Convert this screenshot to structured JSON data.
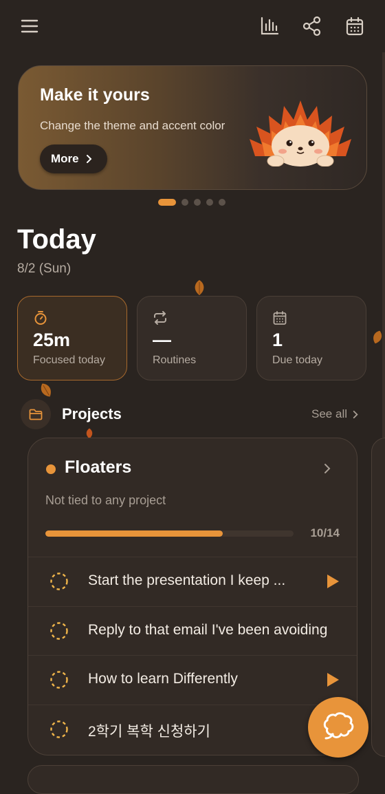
{
  "banner": {
    "title": "Make it yours",
    "subtitle": "Change the theme and accent color",
    "more_label": "More",
    "page_count": 5,
    "active_page": 1
  },
  "today": {
    "title": "Today",
    "date": "8/2 (Sun)"
  },
  "stats": [
    {
      "value": "25m",
      "label": "Focused today",
      "icon": "timer-icon"
    },
    {
      "value": "—",
      "label": "Routines",
      "icon": "repeat-icon"
    },
    {
      "value": "1",
      "label": "Due today",
      "icon": "calendar-icon"
    }
  ],
  "projects": {
    "title": "Projects",
    "see_all": "See all"
  },
  "project_card": {
    "name": "Floaters",
    "subtitle": "Not tied to any project",
    "progress_label": "10/14",
    "progress_done": 10,
    "progress_total": 14,
    "tasks": [
      {
        "text": "Start the presentation I keep ...",
        "has_play": true
      },
      {
        "text": "Reply to that email I've been avoiding",
        "has_play": false
      },
      {
        "text": "How to learn Differently",
        "has_play": true
      },
      {
        "text": "2학기 복학 신청하기",
        "has_play": false
      }
    ]
  },
  "colors": {
    "accent": "#e8943a",
    "background": "#2a2420",
    "card": "#322a25"
  }
}
